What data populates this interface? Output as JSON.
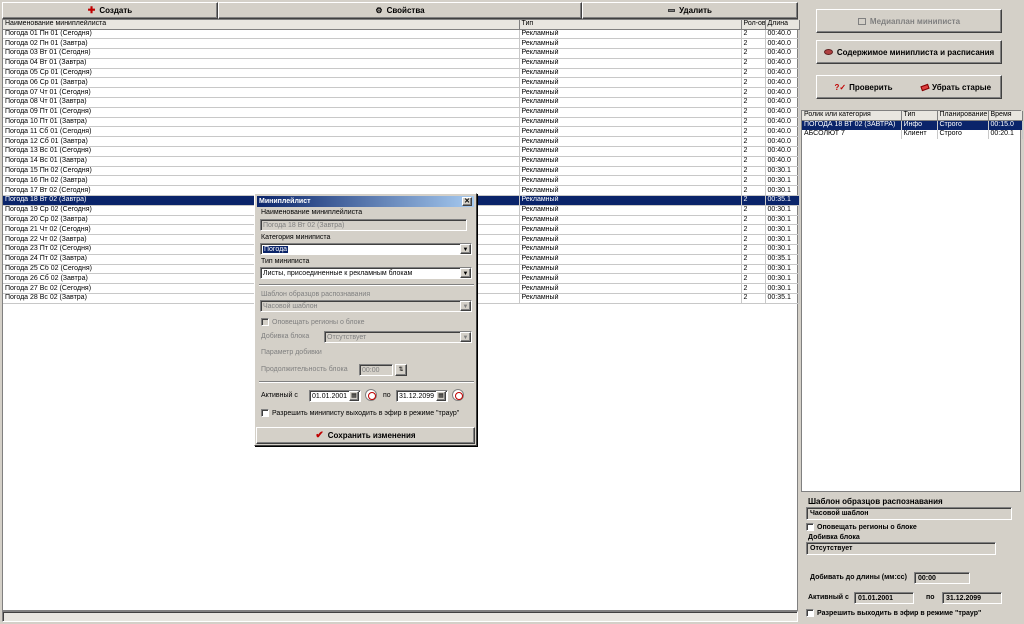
{
  "toolbar": {
    "create_label": "Создать",
    "properties_label": "Свойства",
    "delete_label": "Удалить"
  },
  "grid": {
    "columns": [
      "Наименование миниплейлиста",
      "Тип",
      "Рол-ов",
      "Длина"
    ],
    "selected_index": 17,
    "rows": [
      [
        "Погода 01 Пн 01 (Сегодня)",
        "Рекламный",
        "2",
        "00:40.0"
      ],
      [
        "Погода 02 Пн 01 (Завтра)",
        "Рекламный",
        "2",
        "00:40.0"
      ],
      [
        "Погода 03 Вт 01 (Сегодня)",
        "Рекламный",
        "2",
        "00:40.0"
      ],
      [
        "Погода 04 Вт 01 (Завтра)",
        "Рекламный",
        "2",
        "00:40.0"
      ],
      [
        "Погода 05 Ср 01 (Сегодня)",
        "Рекламный",
        "2",
        "00:40.0"
      ],
      [
        "Погода 06 Ср 01 (Завтра)",
        "Рекламный",
        "2",
        "00:40.0"
      ],
      [
        "Погода 07 Чт 01 (Сегодня)",
        "Рекламный",
        "2",
        "00:40.0"
      ],
      [
        "Погода 08 Чт 01 (Завтра)",
        "Рекламный",
        "2",
        "00:40.0"
      ],
      [
        "Погода 09 Пт 01 (Сегодня)",
        "Рекламный",
        "2",
        "00:40.0"
      ],
      [
        "Погода 10 Пт 01 (Завтра)",
        "Рекламный",
        "2",
        "00:40.0"
      ],
      [
        "Погода 11 Сб 01 (Сегодня)",
        "Рекламный",
        "2",
        "00:40.0"
      ],
      [
        "Погода 12 Сб 01 (Завтра)",
        "Рекламный",
        "2",
        "00:40.0"
      ],
      [
        "Погода 13 Вс 01 (Сегодня)",
        "Рекламный",
        "2",
        "00:40.0"
      ],
      [
        "Погода 14 Вс 01 (Завтра)",
        "Рекламный",
        "2",
        "00:40.0"
      ],
      [
        "Погода 15 Пн 02 (Сегодня)",
        "Рекламный",
        "2",
        "00:30.1"
      ],
      [
        "Погода 16 Пн 02 (Завтра)",
        "Рекламный",
        "2",
        "00:30.1"
      ],
      [
        "Погода 17 Вт 02 (Сегодня)",
        "Рекламный",
        "2",
        "00:30.1"
      ],
      [
        "Погода 18 Вт 02 (Завтра)",
        "Рекламный",
        "2",
        "00:35.1"
      ],
      [
        "Погода 19 Ср 02 (Сегодня)",
        "Рекламный",
        "2",
        "00:30.1"
      ],
      [
        "Погода 20 Ср 02 (Завтра)",
        "Рекламный",
        "2",
        "00:30.1"
      ],
      [
        "Погода 21 Чт 02 (Сегодня)",
        "Рекламный",
        "2",
        "00:30.1"
      ],
      [
        "Погода 22 Чт 02 (Завтра)",
        "Рекламный",
        "2",
        "00:30.1"
      ],
      [
        "Погода 23 Пт 02 (Сегодня)",
        "Рекламный",
        "2",
        "00:30.1"
      ],
      [
        "Погода 24 Пт 02 (Завтра)",
        "Рекламный",
        "2",
        "00:35.1"
      ],
      [
        "Погода 25 Сб 02 (Сегодня)",
        "Рекламный",
        "2",
        "00:30.1"
      ],
      [
        "Погода 26 Сб 02 (Завтра)",
        "Рекламный",
        "2",
        "00:30.1"
      ],
      [
        "Погода 27 Вс 02 (Сегодня)",
        "Рекламный",
        "2",
        "00:30.1"
      ],
      [
        "Погода 28 Вс 02 (Завтра)",
        "Рекламный",
        "2",
        "00:35.1"
      ]
    ]
  },
  "right": {
    "mediaplan_label": "Медиаплан миниписта",
    "content_label": "Содержимое миниплиста и расписания",
    "check_label": "Проверить",
    "remove_old_label": "Убрать старые",
    "columns": [
      "Ролик или категория",
      "Тип",
      "Планирование",
      "Время"
    ],
    "rows": [
      [
        "ПОГОДА 18 ВТ 02 (ЗАВТРА)",
        "Инфо",
        "Строго",
        "00:15.0"
      ],
      [
        "АБСОЛЮТ 7",
        "Клиент",
        "Строго",
        "00:20.1"
      ]
    ],
    "template_label": "Шаблон образцов распознавания",
    "template_value": "Часовой шаблон",
    "notify_label": "Оповещать регионы о блоке",
    "fill_label": "Добивка блока",
    "fill_value": "Отсутствует",
    "fill_length_label": "Добивать до длины (мм:сс)",
    "fill_length_value": "00:00",
    "active_from_label": "Активный с",
    "active_from_value": "01.01.2001",
    "to_label": "по",
    "active_to_value": "31.12.2099",
    "allow_label": "Разрешить выходить в эфир в режиме \"траур\""
  },
  "dialog": {
    "title": "Миниплейлист",
    "close_label": "✕",
    "name_label": "Наименование миниплейлиста",
    "name_value": "Погода 18 Вт 02 (Завтра)",
    "category_label": "Категория миниписта",
    "category_value": "Погода",
    "type_label": "Тип миниписта",
    "type_value": "Листы, присоединенные к рекламным блокам",
    "template_label": "Шаблон образцов распознавания",
    "template_value": "Часовой шаблон",
    "notify_label": "Оповещать регионы о блоке",
    "fill_label": "Добивка блока",
    "fill_value": "Отсутствует",
    "fill_param_label": "Параметр добивки",
    "block_length_label": "Продолжительность блока",
    "block_length_value": "00:00",
    "active_from_label": "Активный с",
    "active_from_value": "01.01.2001",
    "to_label": "по",
    "active_to_value": "31.12.2099",
    "allow_label": "Разрешить миниписту выходить в эфир в режиме \"траур\"",
    "save_label": "Сохранить изменения"
  },
  "colors": {
    "selection": "#0a246a",
    "face": "#d4d0c8",
    "create_icon": "#c00000",
    "save_icon": "#c00000"
  }
}
